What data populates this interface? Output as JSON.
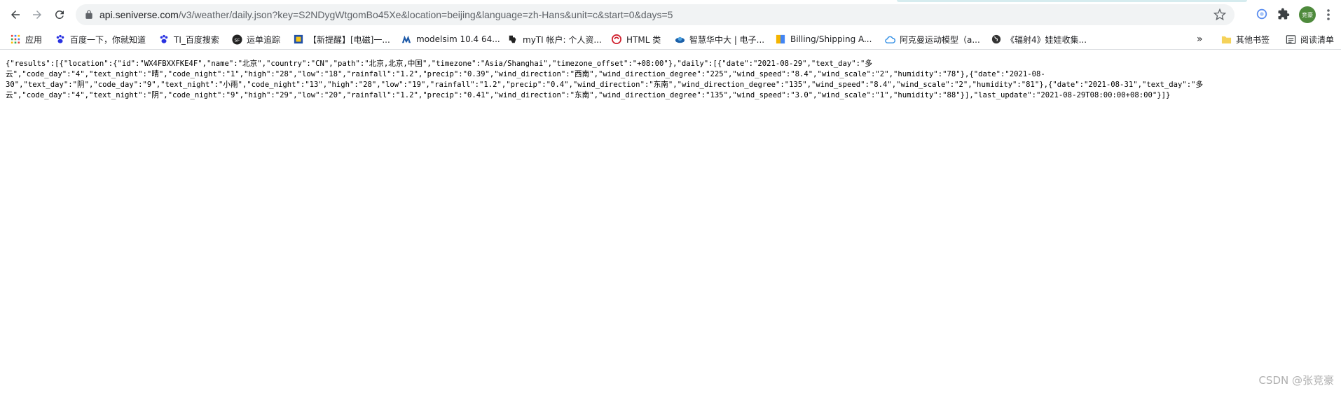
{
  "browser": {
    "url_host": "api.seniverse.com",
    "url_rest": "/v3/weather/daily.json?key=S2NDygWtgomBo45Xe&location=beijing&language=zh-Hans&unit=c&start=0&days=5",
    "avatar_text": "竞豪"
  },
  "bookmarks": {
    "apps": "应用",
    "items": [
      "百度一下，你就知道",
      "TI_百度搜索",
      "运单追踪",
      "【新提醒】[电磁]一...",
      "modelsim 10.4 64...",
      "myTI 帐户: 个人资...",
      "HTML 类",
      "智慧华中大 | 电子...",
      "Billing/Shipping A...",
      "阿克曼运动模型（a...",
      "《辐射4》娃娃收集..."
    ],
    "more": "»",
    "other": "其他书签",
    "reading_list": "阅读清单"
  },
  "content": {
    "json_text": "{\"results\":[{\"location\":{\"id\":\"WX4FBXXFKE4F\",\"name\":\"北京\",\"country\":\"CN\",\"path\":\"北京,北京,中国\",\"timezone\":\"Asia/Shanghai\",\"timezone_offset\":\"+08:00\"},\"daily\":[{\"date\":\"2021-08-29\",\"text_day\":\"多\n云\",\"code_day\":\"4\",\"text_night\":\"晴\",\"code_night\":\"1\",\"high\":\"28\",\"low\":\"18\",\"rainfall\":\"1.2\",\"precip\":\"0.39\",\"wind_direction\":\"西南\",\"wind_direction_degree\":\"225\",\"wind_speed\":\"8.4\",\"wind_scale\":\"2\",\"humidity\":\"78\"},{\"date\":\"2021-08-\n30\",\"text_day\":\"阴\",\"code_day\":\"9\",\"text_night\":\"小雨\",\"code_night\":\"13\",\"high\":\"28\",\"low\":\"19\",\"rainfall\":\"1.2\",\"precip\":\"0.4\",\"wind_direction\":\"东南\",\"wind_direction_degree\":\"135\",\"wind_speed\":\"8.4\",\"wind_scale\":\"2\",\"humidity\":\"81\"},{\"date\":\"2021-08-31\",\"text_day\":\"多\n云\",\"code_day\":\"4\",\"text_night\":\"阴\",\"code_night\":\"9\",\"high\":\"29\",\"low\":\"20\",\"rainfall\":\"1.2\",\"precip\":\"0.41\",\"wind_direction\":\"东南\",\"wind_direction_degree\":\"135\",\"wind_speed\":\"3.0\",\"wind_scale\":\"1\",\"humidity\":\"88\"}],\"last_update\":\"2021-08-29T08:00:00+08:00\"}]}"
  },
  "watermark": "CSDN @张竞豪",
  "colors": {
    "omnibox_bg": "#f1f3f4",
    "tab_accent": "#d6ecef"
  }
}
